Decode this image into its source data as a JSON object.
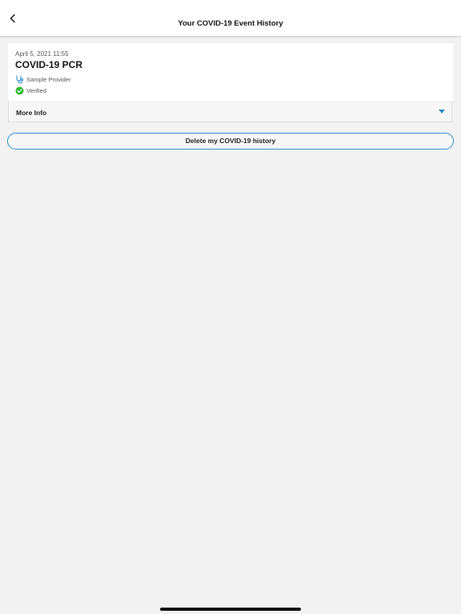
{
  "nav": {
    "title": "Your COVID-19 Event History",
    "back_icon": "chevron-left-icon"
  },
  "event": {
    "date": "April 5, 2021 11:55",
    "name": "COVID-19 PCR",
    "provider": "Sample Provider",
    "provider_icon": "stethoscope-icon",
    "status": "Verified",
    "status_icon": "check-circle-icon"
  },
  "more_info": {
    "label": "More Info",
    "chevron_icon": "caret-down-icon"
  },
  "actions": {
    "delete_label": "Delete my COVID-19 history"
  },
  "colors": {
    "accent": "#2c89c8",
    "verified": "#2eb82e",
    "background": "#f2f2f2"
  }
}
